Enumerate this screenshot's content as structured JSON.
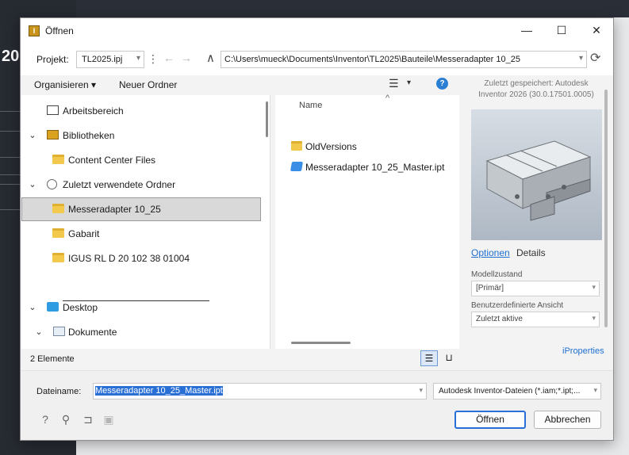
{
  "background": {
    "year_text": "20"
  },
  "dialog": {
    "title": "Öffnen",
    "icon": "inventor-app-icon",
    "window_controls": {
      "minimize": "—",
      "maximize": "☐",
      "close": "✕"
    }
  },
  "project": {
    "label": "Projekt:",
    "value": "TL2025.ipj",
    "path": "C:\\Users\\mueck\\Documents\\Inventor\\TL2025\\Bauteile\\Messeradapter 10_25"
  },
  "toolbar": {
    "organize_label": "Organisieren",
    "new_folder_label": "Neuer Ordner"
  },
  "nav": {
    "items": [
      {
        "label": "Arbeitsbereich",
        "icon": "workspace-icon",
        "chevron": "",
        "indent": 1
      },
      {
        "label": "Bibliotheken",
        "icon": "library-icon",
        "chevron": "⌄",
        "indent": 1
      },
      {
        "label": "Content Center Files",
        "icon": "folder-icon",
        "chevron": "",
        "indent": 2
      },
      {
        "label": "Zuletzt verwendete Ordner",
        "icon": "recent-icon",
        "chevron": "⌄",
        "indent": 1
      },
      {
        "label": "Messeradapter 10_25",
        "icon": "folder-icon",
        "chevron": "",
        "indent": 2,
        "selected": true
      },
      {
        "label": "Gabarit",
        "icon": "folder-icon",
        "chevron": "",
        "indent": 2
      },
      {
        "label": "IGUS RL D 20 102 38 01004",
        "icon": "folder-icon",
        "chevron": "",
        "indent": 2
      },
      {
        "label": "Desktop",
        "icon": "desktop-icon",
        "chevron": "⌄",
        "indent": 1
      },
      {
        "label": "Dokumente",
        "icon": "documents-icon",
        "chevron": "⌄",
        "indent": 1
      }
    ]
  },
  "files": {
    "column_name": "Name",
    "rows": [
      {
        "label": "OldVersions",
        "icon": "folder-icon"
      },
      {
        "label": "Messeradapter 10_25_Master.ipt",
        "icon": "part-file-icon"
      }
    ]
  },
  "status": {
    "item_count": "2 Elemente"
  },
  "preview": {
    "saved_with": "Zuletzt gespeichert: Autodesk Inventor 2026 (30.0.17501.0005)",
    "tab_options": "Optionen",
    "tab_details": "Details",
    "model_state_label": "Modellzustand",
    "model_state_value": "[Primär]",
    "design_view_label": "Benutzerdefinierte Ansicht",
    "design_view_value": "Zuletzt aktive",
    "properties_link": "iProperties"
  },
  "bottom": {
    "filename_label": "Dateiname:",
    "filename_value": "Messeradapter 10_25_Master.ipt",
    "filetype_value": "Autodesk Inventor-Dateien (*.iam;*.ipt;...",
    "open_label": "Öffnen",
    "cancel_label": "Abbrechen"
  }
}
